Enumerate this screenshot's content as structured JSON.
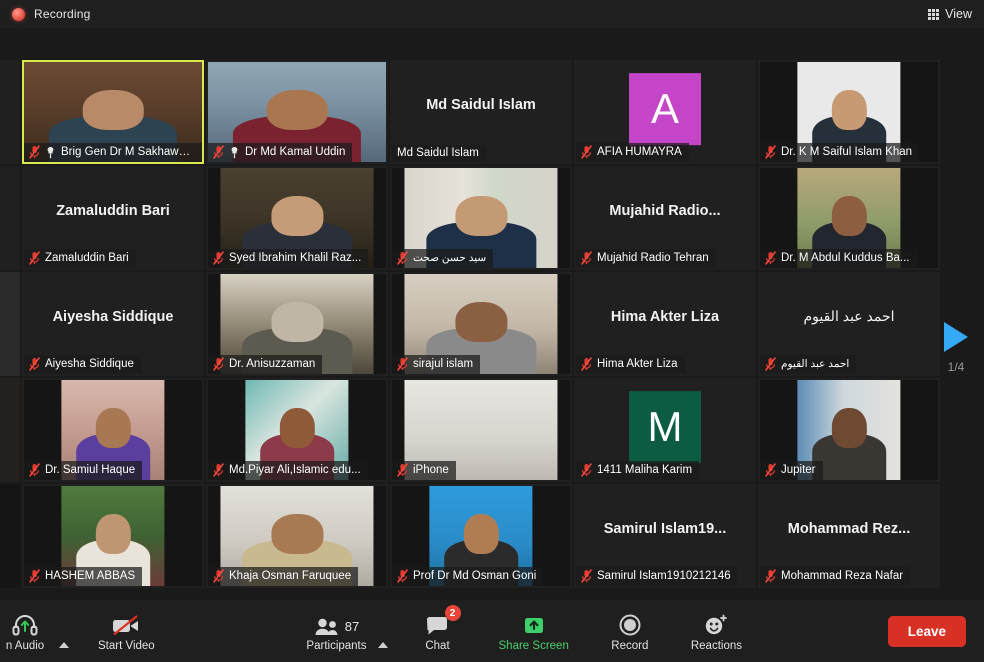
{
  "topbar": {
    "recording_label": "Recording",
    "view_label": "View",
    "view_icon": "grid-icon",
    "recording_icon": "recording-dot-icon"
  },
  "gallery": {
    "page_indicator": "1/4",
    "next_page_icon": "triangle-right-icon",
    "tiles": [
      {
        "name": "Brig Gen Dr M Sakhawat...",
        "full_name": "Brig Gen Dr M Sakhawat Hussain",
        "video": true,
        "muted": true,
        "pinned": true,
        "active_speaker": true,
        "avatar_letter": null,
        "avatar_color": null,
        "scene": "bookshelf-man-grey-hair"
      },
      {
        "name": "Dr Md Kamal Uddin",
        "full_name": "Dr Md Kamal Uddin",
        "video": true,
        "muted": true,
        "pinned": true,
        "active_speaker": false,
        "avatar_letter": null,
        "avatar_color": null,
        "scene": "bookshelf-man-maroon"
      },
      {
        "name": "Md Saidul Islam",
        "full_name": "Md Saidul Islam",
        "video": false,
        "muted": false,
        "pinned": false,
        "active_speaker": false,
        "avatar_letter": null,
        "avatar_color": null,
        "scene": null
      },
      {
        "name": "AFIA HUMAYRA",
        "full_name": "AFIA HUMAYRA",
        "video": false,
        "muted": true,
        "pinned": false,
        "active_speaker": false,
        "avatar_letter": "A",
        "avatar_color": "#c545c8",
        "scene": null
      },
      {
        "name": "Dr. K M Saiful Islam Khan",
        "full_name": "Dr. K M Saiful Islam Khan",
        "video": true,
        "muted": true,
        "pinned": false,
        "active_speaker": false,
        "avatar_letter": null,
        "avatar_color": null,
        "scene": "portrait-beard-cap"
      },
      {
        "name": "Zamaluddin Bari",
        "full_name": "Zamaluddin Bari",
        "video": false,
        "muted": true,
        "pinned": false,
        "active_speaker": false,
        "avatar_letter": null,
        "avatar_color": null,
        "scene": null
      },
      {
        "name": "Syed Ibrahim Khalil Raz...",
        "full_name": "Syed Ibrahim Khalil Razavi",
        "video": true,
        "muted": true,
        "pinned": false,
        "active_speaker": false,
        "avatar_letter": null,
        "avatar_color": null,
        "scene": "cleric-turban-library"
      },
      {
        "name": "سيد حسن صحت",
        "full_name": "سيد حسن صحت",
        "video": true,
        "muted": true,
        "pinned": false,
        "active_speaker": false,
        "rtl": true,
        "avatar_letter": null,
        "avatar_color": null,
        "scene": "man-suit-iran-flag"
      },
      {
        "name": "Mujahid Radio Tehran",
        "full_name": "Mujahid  Radio...",
        "video": false,
        "muted": true,
        "pinned": false,
        "active_speaker": false,
        "avatar_letter": null,
        "avatar_color": null,
        "scene": null
      },
      {
        "name": "Dr. M Abdul Kuddus Ba...",
        "full_name": "Dr. M Abdul Kuddus Badhon",
        "video": true,
        "muted": true,
        "pinned": false,
        "active_speaker": false,
        "avatar_letter": null,
        "avatar_color": null,
        "scene": "outdoor-sunglasses-man"
      },
      {
        "name": "Aiyesha Siddique",
        "full_name": "Aiyesha Siddique",
        "video": false,
        "muted": true,
        "pinned": false,
        "active_speaker": false,
        "avatar_letter": null,
        "avatar_color": null,
        "scene": null
      },
      {
        "name": "Dr. Anisuzzaman",
        "full_name": "Dr. Anisuzzaman",
        "video": true,
        "muted": true,
        "pinned": false,
        "active_speaker": false,
        "avatar_letter": null,
        "avatar_color": null,
        "scene": "bearded-elder-books"
      },
      {
        "name": "sirajul islam",
        "full_name": "sirajul islam",
        "video": true,
        "muted": true,
        "pinned": false,
        "active_speaker": false,
        "avatar_letter": null,
        "avatar_color": null,
        "scene": "man-grey-suit-room"
      },
      {
        "name": "Hima Akter Liza",
        "full_name": "Hima Akter Liza",
        "video": false,
        "muted": true,
        "pinned": false,
        "active_speaker": false,
        "avatar_letter": null,
        "avatar_color": null,
        "scene": null
      },
      {
        "name": "احمد عبد القيوم",
        "full_name": "احمد عبد القيوم",
        "video": false,
        "muted": true,
        "pinned": false,
        "active_speaker": false,
        "rtl": true,
        "avatar_letter": null,
        "avatar_color": null,
        "scene": null
      },
      {
        "name": "Dr. Samiul Haque",
        "full_name": "Dr. Samiul Haque",
        "video": true,
        "muted": true,
        "pinned": false,
        "active_speaker": false,
        "avatar_letter": null,
        "avatar_color": null,
        "scene": "man-purple-suit-curtain"
      },
      {
        "name": "Md.Piyar Ali,Islamic edu...",
        "full_name": "Md.Piyar Ali,Islamic education",
        "video": true,
        "muted": true,
        "pinned": false,
        "active_speaker": false,
        "avatar_letter": null,
        "avatar_color": null,
        "scene": "young-man-teal-stripes"
      },
      {
        "name": "iPhone",
        "full_name": "iPhone",
        "video": true,
        "muted": true,
        "pinned": false,
        "active_speaker": false,
        "avatar_letter": null,
        "avatar_color": null,
        "scene": "blank-wall"
      },
      {
        "name": "1411 Maliha Karim",
        "full_name": "1411 Maliha Karim",
        "video": false,
        "muted": true,
        "pinned": false,
        "active_speaker": false,
        "avatar_letter": "M",
        "avatar_color": "#0b5c42",
        "scene": null
      },
      {
        "name": "Jupiter",
        "full_name": "Jupiter",
        "video": true,
        "muted": true,
        "pinned": false,
        "active_speaker": false,
        "avatar_letter": null,
        "avatar_color": null,
        "scene": "man-jacket-window"
      },
      {
        "name": "HASHEM ABBAS",
        "full_name": "HASHEM ABBAS",
        "video": true,
        "muted": true,
        "pinned": false,
        "active_speaker": false,
        "avatar_letter": null,
        "avatar_color": null,
        "scene": "cleric-white-cap-green"
      },
      {
        "name": "Khaja Osman Faruquee",
        "full_name": "Khaja Osman Faruquee",
        "video": true,
        "muted": true,
        "pinned": false,
        "active_speaker": false,
        "avatar_letter": null,
        "avatar_color": null,
        "scene": "man-glasses-white-wall"
      },
      {
        "name": "Prof Dr Md Osman Goni",
        "full_name": "Prof Dr Md Osman Goni",
        "video": true,
        "muted": true,
        "pinned": false,
        "active_speaker": false,
        "avatar_letter": null,
        "avatar_color": null,
        "scene": "man-blue-background"
      },
      {
        "name": "Samirul Islam1910212146",
        "full_name": "Samirul Islam19...",
        "video": false,
        "muted": true,
        "pinned": false,
        "active_speaker": false,
        "avatar_letter": null,
        "avatar_color": null,
        "scene": null
      },
      {
        "name": "Mohammad Reza Nafar",
        "full_name": "Mohammad  Rez...",
        "video": false,
        "muted": true,
        "pinned": false,
        "active_speaker": false,
        "avatar_letter": null,
        "avatar_color": null,
        "scene": null
      }
    ]
  },
  "toolbar": {
    "audio_label": "n Audio",
    "audio_icon": "headset-arrow-up-icon",
    "video_label": "Start Video",
    "video_icon": "camera-slash-icon",
    "participants_label": "Participants",
    "participants_count": "87",
    "participants_icon": "people-icon",
    "chat_label": "Chat",
    "chat_icon": "chat-bubble-icon",
    "chat_badge": "2",
    "share_label": "Share Screen",
    "share_icon": "share-arrow-up-icon",
    "record_label": "Record",
    "record_icon": "record-circle-icon",
    "reactions_label": "Reactions",
    "reactions_icon": "smiley-plus-icon",
    "leave_label": "Leave"
  },
  "colors": {
    "accent_blue": "#35a9f5",
    "leave_red": "#d93025",
    "share_green": "#4ccf6a",
    "active_border": "#d9e84a",
    "badge_red": "#e8443a"
  }
}
